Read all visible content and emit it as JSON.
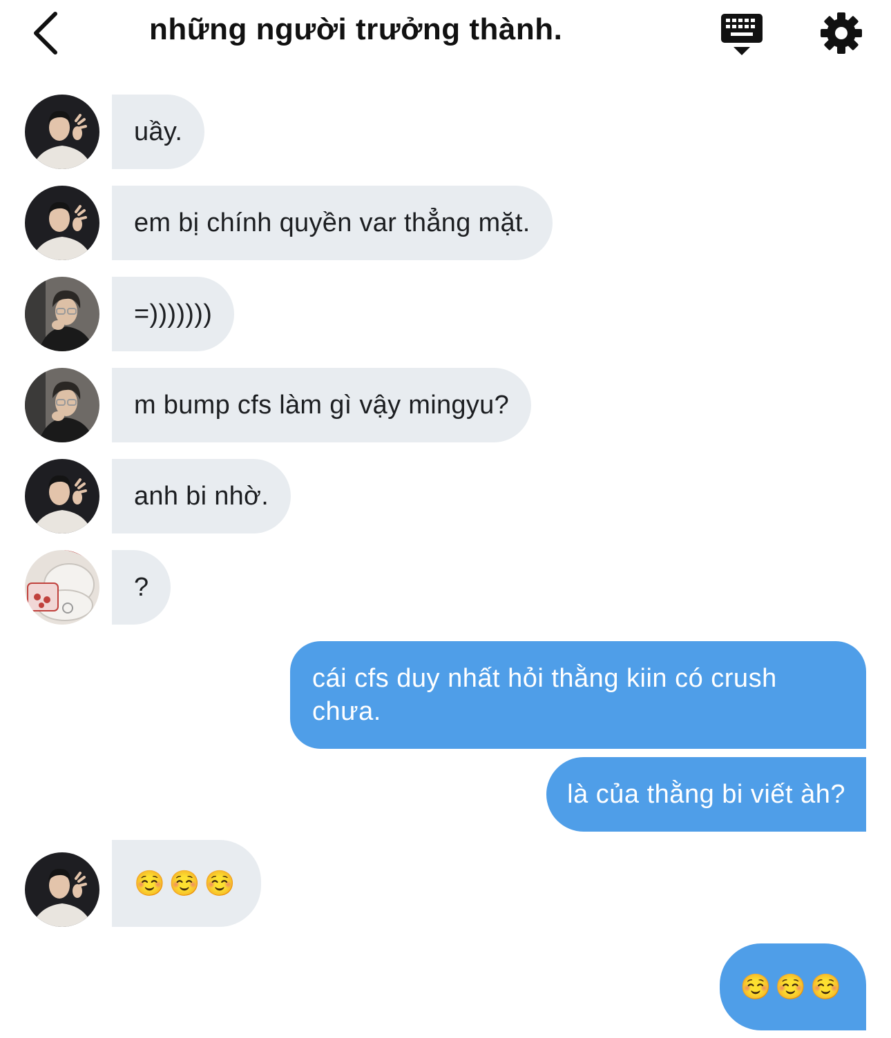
{
  "header": {
    "title": "những người trưởng thành."
  },
  "messages": [
    {
      "side": "in",
      "avatar": "person-a-avatar",
      "text": "uầy."
    },
    {
      "side": "in",
      "avatar": "person-a-avatar",
      "text": "em bị chính quyền var thẳng mặt."
    },
    {
      "side": "in",
      "avatar": "person-b-avatar",
      "text": "=)))))))"
    },
    {
      "side": "in",
      "avatar": "person-b-avatar",
      "text": "m bump cfs làm gì vậy mingyu?"
    },
    {
      "side": "in",
      "avatar": "person-a-avatar",
      "text": "anh bi nhờ."
    },
    {
      "side": "in",
      "avatar": "bear-avatar",
      "text": "?"
    },
    {
      "side": "out",
      "text": "cái cfs duy nhất hỏi thằng kiin có crush chưa."
    },
    {
      "side": "out",
      "text": "là của thằng bi viết àh?"
    },
    {
      "side": "in",
      "avatar": "person-a-avatar",
      "text": "☺️☺️☺️"
    },
    {
      "side": "out",
      "text": "☺️☺️☺️"
    }
  ],
  "colors": {
    "incoming_bubble": "#e8ecf0",
    "outgoing_bubble": "#4f9ee8"
  }
}
